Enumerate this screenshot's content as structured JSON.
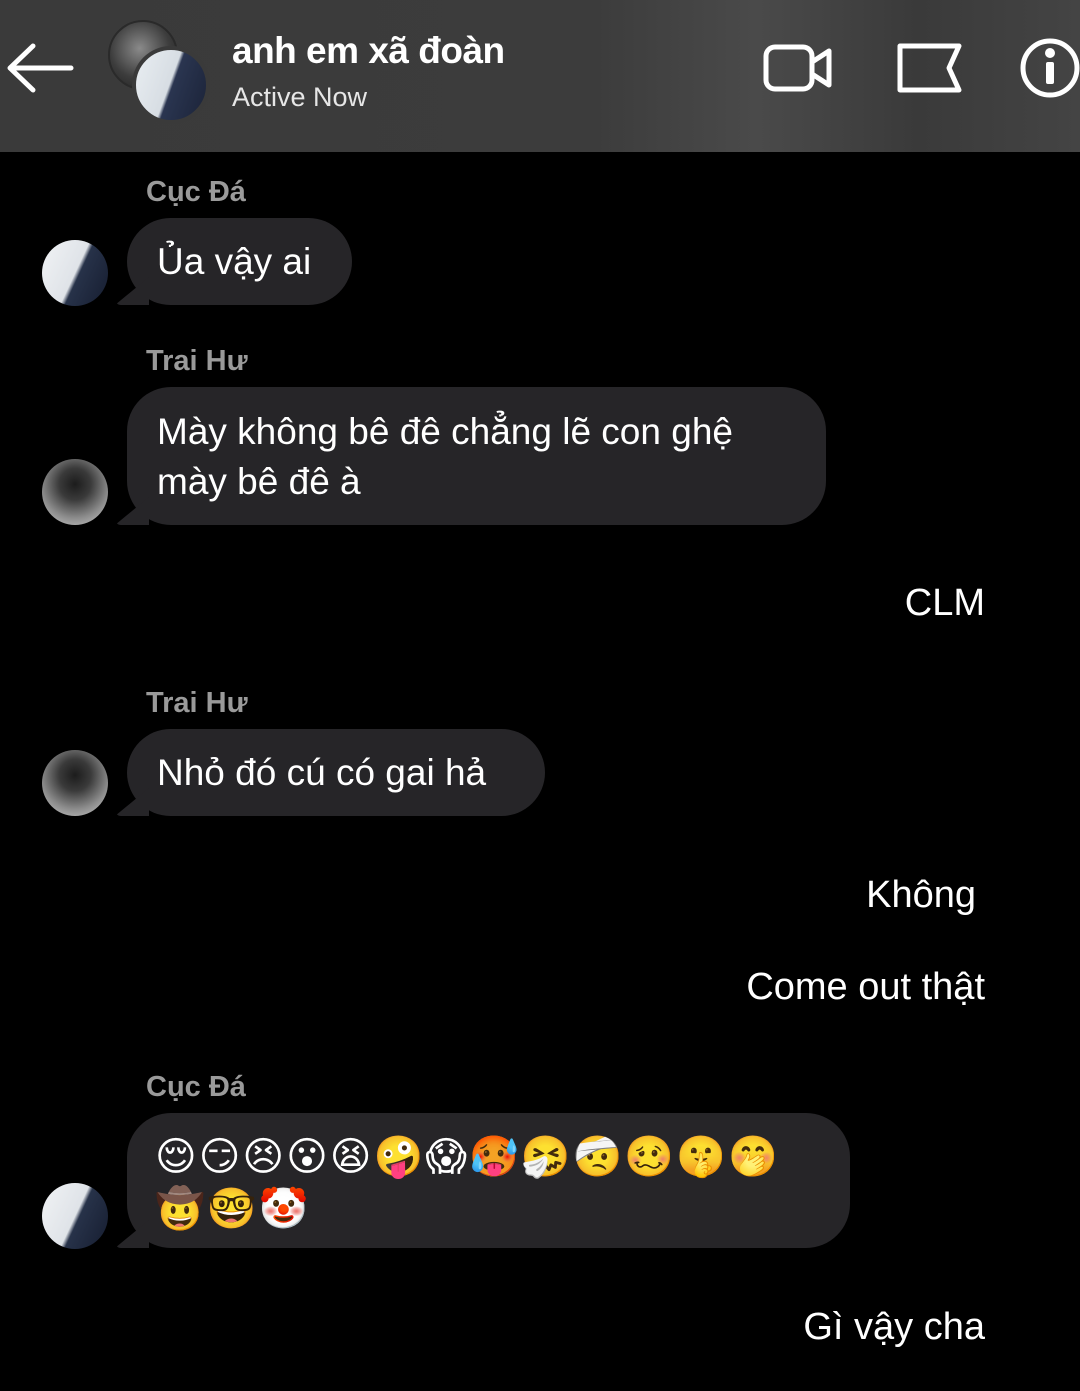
{
  "header": {
    "title": "anh em xã đoàn",
    "status": "Active Now"
  },
  "messages": [
    {
      "sender": "Cục Đá",
      "text": "Ủa vậy ai"
    },
    {
      "sender": "Trai Hư",
      "line1": "Mày không bê đê chẳng lẽ con ghệ",
      "line2": "mày bê đê à"
    },
    {
      "mine": "CLM"
    },
    {
      "sender": "Trai Hư",
      "text": "Nhỏ đó cú có gai hả"
    },
    {
      "mine": "Không"
    },
    {
      "mine": "Come out thật"
    },
    {
      "sender": "Cục Đá",
      "emoji_line1": "😌😏😣😮😫🤪😱🥵🤧🤕🥴🤫🤭",
      "emoji_line2": "🤠🤓🤡"
    },
    {
      "mine": "Gì vậy cha"
    }
  ],
  "colors": {
    "background": "#000000",
    "header": "#3a3a3a",
    "bubble": "#262528",
    "sender_name": "#9a9a9a"
  }
}
